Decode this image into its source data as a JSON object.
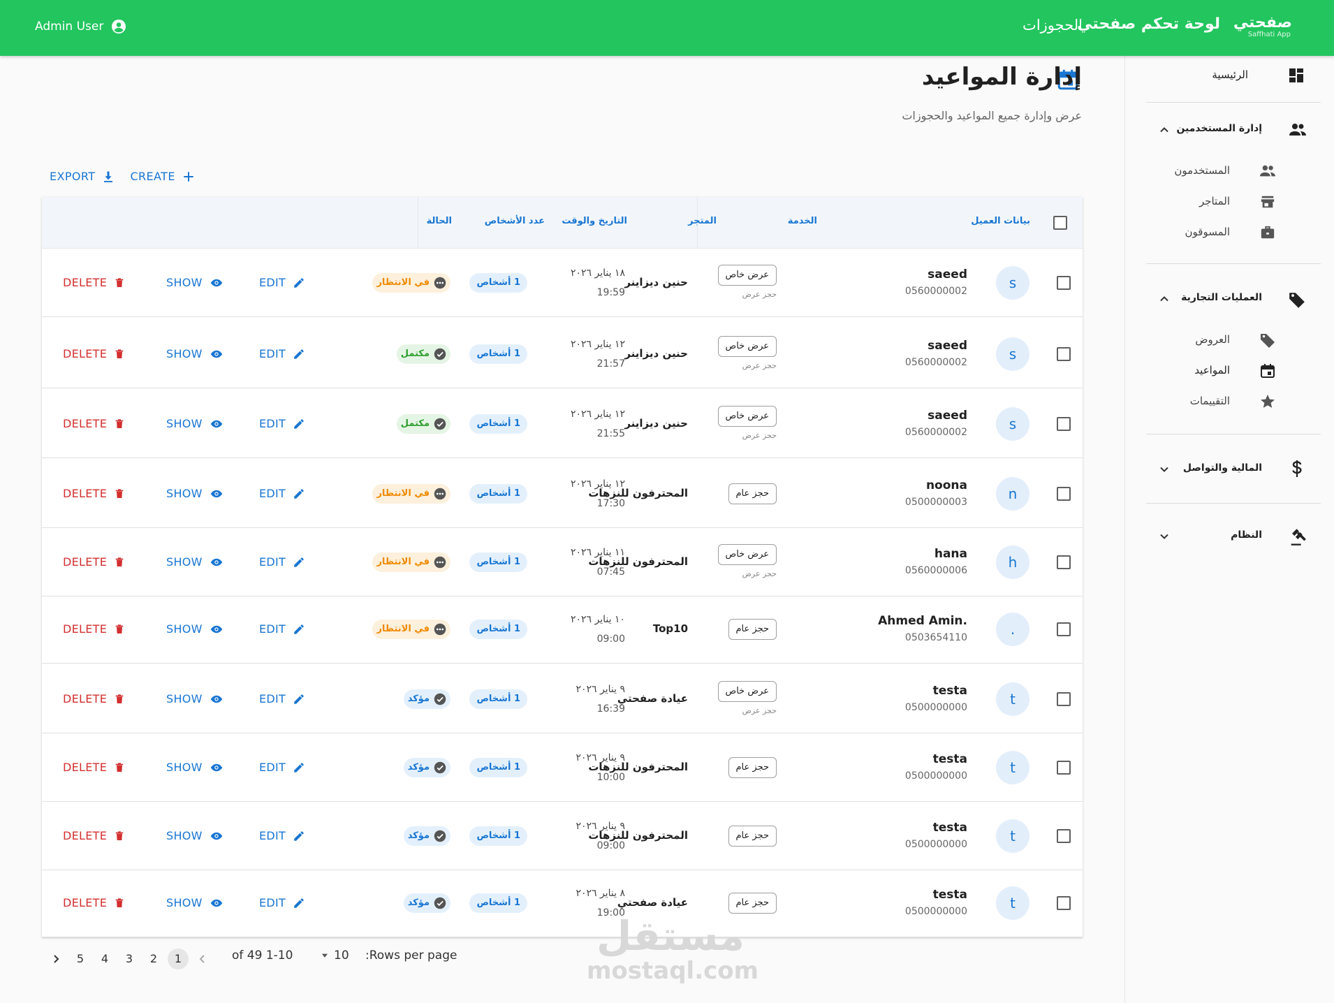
{
  "appbar": {
    "logo_text": "صفحتي",
    "logo_sub": "Saffhati App",
    "app_title": "لوحة تحكم صفحتي",
    "nav_bookings": "الحجوزات",
    "user_name": "Admin User",
    "bg_color": "#22c55e"
  },
  "sidebar": {
    "home": "الرئيسية",
    "groups": [
      {
        "label": "إدارة المستخدمين",
        "items": [
          "المستخدمون",
          "المتاجر",
          "المسوقون"
        ]
      },
      {
        "label": "العمليات التجارية",
        "items": [
          "العروض",
          "المواعيد",
          "التقييمات"
        ]
      },
      {
        "label": "المالية والتواصل"
      },
      {
        "label": "النظام"
      }
    ]
  },
  "page": {
    "title": "إدارة المواعيد",
    "subtitle": "عرض وإدارة جميع المواعيد والحجوزات"
  },
  "toolbar": {
    "export": "EXPORT",
    "create": "CREATE"
  },
  "table": {
    "headers": {
      "client": "بيانات العميل",
      "service": "الخدمة",
      "store": "المتجر",
      "datetime": "التاريخ والوقت",
      "people": "عدد الأشخاص",
      "status": "الحالة"
    },
    "actions": {
      "edit": "EDIT",
      "show": "SHOW",
      "delete": "DELETE"
    },
    "rows": [
      {
        "initial": "s",
        "name": "saeed",
        "phone": "0560000002",
        "service": "عرض خاص",
        "service_sub": "حجز عرض",
        "store": "حنين ديزاينر",
        "date": "١٨ يناير ٢٠٢٦",
        "time": "19:59",
        "people": "1 أشخاص",
        "status": "في الانتظار",
        "status_type": "pending"
      },
      {
        "initial": "s",
        "name": "saeed",
        "phone": "0560000002",
        "service": "عرض خاص",
        "service_sub": "حجز عرض",
        "store": "حنين ديزاينر",
        "date": "١٢ يناير ٢٠٢٦",
        "time": "21:57",
        "people": "1 أشخاص",
        "status": "مكتمل",
        "status_type": "done"
      },
      {
        "initial": "s",
        "name": "saeed",
        "phone": "0560000002",
        "service": "عرض خاص",
        "service_sub": "حجز عرض",
        "store": "حنين ديزاينر",
        "date": "١٢ يناير ٢٠٢٦",
        "time": "21:55",
        "people": "1 أشخاص",
        "status": "مكتمل",
        "status_type": "done"
      },
      {
        "initial": "n",
        "name": "noona",
        "phone": "0500000003",
        "service": "حجز عام",
        "service_sub": "",
        "store": "المحترفون للنزهات",
        "date": "١٢ يناير ٢٠٢٦",
        "time": "17:30",
        "people": "1 أشخاص",
        "status": "في الانتظار",
        "status_type": "pending"
      },
      {
        "initial": "h",
        "name": "hana",
        "phone": "0560000006",
        "service": "عرض خاص",
        "service_sub": "حجز عرض",
        "store": "المحترفون للنزهات",
        "date": "١١ يناير ٢٠٢٦",
        "time": "07:45",
        "people": "1 أشخاص",
        "status": "في الانتظار",
        "status_type": "pending"
      },
      {
        "initial": ".",
        "name": "Ahmed Amin.",
        "phone": "0503654110",
        "service": "حجز عام",
        "service_sub": "",
        "store": "Top10",
        "date": "١٠ يناير ٢٠٢٦",
        "time": "09:00",
        "people": "1 أشخاص",
        "status": "في الانتظار",
        "status_type": "pending"
      },
      {
        "initial": "t",
        "name": "testa",
        "phone": "0500000000",
        "service": "عرض خاص",
        "service_sub": "حجز عرض",
        "store": "عيادة صفحتي",
        "date": "٩ يناير ٢٠٢٦",
        "time": "16:39",
        "people": "1 أشخاص",
        "status": "مؤكد",
        "status_type": "confirmed"
      },
      {
        "initial": "t",
        "name": "testa",
        "phone": "0500000000",
        "service": "حجز عام",
        "service_sub": "",
        "store": "المحترفون للنزهات",
        "date": "٩ يناير ٢٠٢٦",
        "time": "10:00",
        "people": "1 أشخاص",
        "status": "مؤكد",
        "status_type": "confirmed"
      },
      {
        "initial": "t",
        "name": "testa",
        "phone": "0500000000",
        "service": "حجز عام",
        "service_sub": "",
        "store": "المحترفون للنزهات",
        "date": "٩ يناير ٢٠٢٦",
        "time": "09:00",
        "people": "1 أشخاص",
        "status": "مؤكد",
        "status_type": "confirmed"
      },
      {
        "initial": "t",
        "name": "testa",
        "phone": "0500000000",
        "service": "حجز عام",
        "service_sub": "",
        "store": "عيادة صفحتي",
        "date": "٨ يناير ٢٠٢٦",
        "time": "19:00",
        "people": "1 أشخاص",
        "status": "مؤكد",
        "status_type": "confirmed"
      }
    ]
  },
  "pagination": {
    "rows_per_page_label": ":Rows per page",
    "rows_per_page": "10",
    "range": "1-10 of 49",
    "pages": [
      "1",
      "2",
      "3",
      "4",
      "5"
    ],
    "current_page": "1"
  },
  "watermark": {
    "line1": "مستقل",
    "line2": "mostaql.com"
  },
  "colors": {
    "primary": "#1976d2",
    "danger": "#d32f2f",
    "pending": "#ef8a00",
    "done": "#2e9e2e"
  }
}
